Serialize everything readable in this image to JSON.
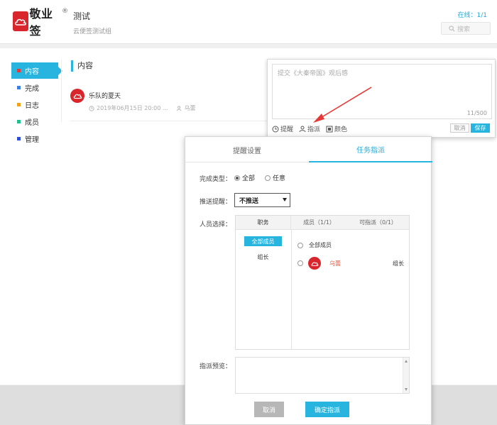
{
  "header": {
    "logo_text": "敬业签",
    "logo_reg": "®",
    "title": "测试",
    "subtitle": "云便签测试组",
    "online": "在线：1/1",
    "search_placeholder": "搜索"
  },
  "sidebar": {
    "items": [
      {
        "label": "内容",
        "color": "#e23b3b"
      },
      {
        "label": "完成",
        "color": "#3b7ee2"
      },
      {
        "label": "日志",
        "color": "#f0a21b"
      },
      {
        "label": "成员",
        "color": "#1ec08c"
      },
      {
        "label": "管理",
        "color": "#2d4fd6"
      }
    ]
  },
  "content": {
    "section_title": "内容",
    "item": {
      "name": "乐队的夏天",
      "datetime": "2019年06月15日 20:00 ...",
      "user": "乌蕾"
    }
  },
  "comment": {
    "placeholder": "提交《大秦帝国》观后感",
    "count": "11/500",
    "tools": {
      "remind": "提醒",
      "assign": "指派",
      "color": "颜色"
    },
    "cancel": "取消",
    "save": "保存"
  },
  "dialog": {
    "tabs": [
      "提醒设置",
      "任务指派"
    ],
    "complete_type_label": "完成类型：",
    "complete_options": [
      "全部",
      "任意"
    ],
    "push_label": "推送提醒：",
    "push_value": "不推送",
    "people_label": "人员选择：",
    "people_head": {
      "role": "职务",
      "members": "成员（1/1）",
      "assignable": "可指派（0/1）"
    },
    "roles": [
      "全部成员",
      "组长"
    ],
    "all_members": "全部成员",
    "member": {
      "name": "乌蕾",
      "role": "组长"
    },
    "preview_label": "指派预览：",
    "cancel": "取消",
    "confirm": "确定指派"
  },
  "colors": {
    "accent": "#27b5e0",
    "brand": "#d9262c"
  }
}
